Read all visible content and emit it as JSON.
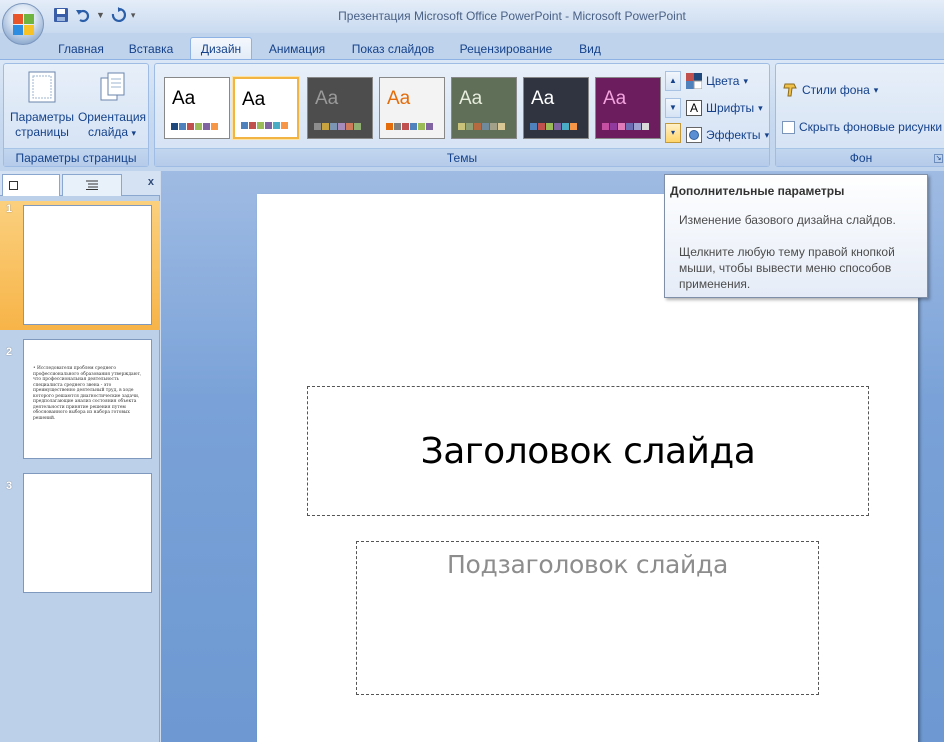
{
  "window": {
    "title": "Презентация Microsoft Office PowerPoint - Microsoft PowerPoint"
  },
  "quick_access": {
    "save_icon": "save-icon",
    "undo_icon": "undo-icon",
    "redo_icon": "redo-icon",
    "customize_icon": "customize-icon"
  },
  "tabs": [
    {
      "label": "Главная",
      "active": false
    },
    {
      "label": "Вставка",
      "active": false
    },
    {
      "label": "Дизайн",
      "active": true
    },
    {
      "label": "Анимация",
      "active": false
    },
    {
      "label": "Показ слайдов",
      "active": false
    },
    {
      "label": "Рецензирование",
      "active": false
    },
    {
      "label": "Вид",
      "active": false
    }
  ],
  "ribbon": {
    "page_setup": {
      "label": "Параметры страницы",
      "params_label_1": "Параметры",
      "params_label_2": "страницы",
      "orient_label_1": "Ориентация",
      "orient_label_2": "слайда",
      "orient_arrow": "▾"
    },
    "themes": {
      "label": "Темы",
      "gallery": [
        {
          "aa": "Aa",
          "bg": "#ffffff",
          "fg": "#000000",
          "swatches": [
            "#1f497d",
            "#4f81bd",
            "#c0504d",
            "#9bbb59",
            "#8064a2",
            "#f79646"
          ]
        },
        {
          "aa": "Aa",
          "bg": "#ffffff",
          "fg": "#000000",
          "swatches": [
            "#4f81bd",
            "#c0504d",
            "#9bbb59",
            "#8064a2",
            "#4bacc6",
            "#f79646"
          ]
        },
        {
          "aa": "Aa",
          "bg": "#4d4d4d",
          "fg": "#9a9a9a",
          "swatches": [
            "#8d8d8d",
            "#c9a33f",
            "#7b95b3",
            "#a58abc",
            "#cf7a5a",
            "#8fb072"
          ]
        },
        {
          "aa": "Aa",
          "bg": "#f3f3f3",
          "fg": "#e46c0a",
          "swatches": [
            "#e46c0a",
            "#7f7f7f",
            "#c0504d",
            "#4f81bd",
            "#9bbb59",
            "#8064a2"
          ]
        },
        {
          "aa": "Aa",
          "bg": "#5f6f58",
          "fg": "#e8ecdc",
          "swatches": [
            "#c9c27b",
            "#8c9f75",
            "#b56b3f",
            "#6e8a9b",
            "#a3a08a",
            "#d9c895"
          ]
        },
        {
          "aa": "Aa",
          "bg": "#2f3440",
          "fg": "#ffffff",
          "swatches": [
            "#4f81bd",
            "#c0504d",
            "#9bbb59",
            "#8064a2",
            "#4bacc6",
            "#f79646"
          ]
        },
        {
          "aa": "Aa",
          "bg": "#6c1d5e",
          "fg": "#f2a3dd",
          "swatches": [
            "#c44fa3",
            "#8f3a9c",
            "#e07bb9",
            "#6d6db3",
            "#a0a0d0",
            "#d9d9d9"
          ]
        }
      ],
      "colors_label": "Цвета",
      "fonts_label": "Шрифты",
      "effects_label": "Эффекты",
      "arrow": "▾",
      "fonts_icon_letter": "A"
    },
    "background": {
      "label": "Фон",
      "styles_label": "Стили фона",
      "hide_label": "Скрыть фоновые рисунки",
      "arrow": "▾"
    }
  },
  "slides_pane": {
    "close": "x",
    "thumbs": [
      {
        "number": "1",
        "selected": true,
        "text": ""
      },
      {
        "number": "2",
        "selected": false,
        "text": "•  Исследователи проблем среднего профессионального образования утверждают, что профессиональная деятельность специалиста среднего звена - это преимущественно деятельный труд, в ходе которого решаются диагностические задачи, предполагающие анализ состояния объекта деятельности принятие решения путем обоснованного выбора из набора готовых решений."
      },
      {
        "number": "3",
        "selected": false,
        "text": ""
      }
    ]
  },
  "slide": {
    "title_placeholder": "Заголовок слайда",
    "subtitle_placeholder": "Подзаголовок слайда"
  },
  "tooltip": {
    "title": "Дополнительные параметры",
    "line1": "Изменение базового дизайна слайдов.",
    "line2": "Щелкните любую тему правой кнопкой мыши, чтобы вывести меню способов применения."
  }
}
